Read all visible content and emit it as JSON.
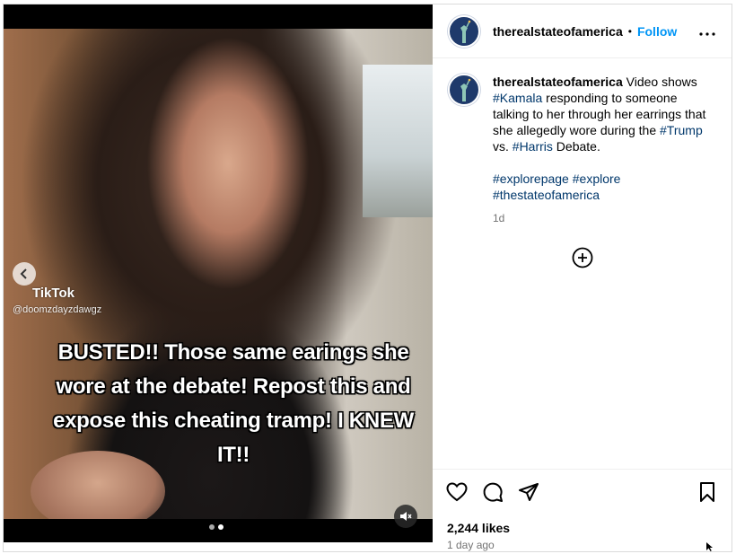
{
  "post": {
    "username": "therealstateofamerica",
    "separator": "•",
    "follow_label": "Follow",
    "more_label": "•••"
  },
  "media": {
    "watermark_brand": "TikTok",
    "watermark_handle": "@doomzdayzdawgz",
    "overlay_text": "BUSTED!! Those same earings she wore at the debate! Repost this and expose this cheating tramp! I KNEW IT!!",
    "slide_count": 2,
    "active_slide": 2
  },
  "caption": {
    "username": "therealstateofamerica",
    "t1": " Video shows ",
    "h1": "#Kamala",
    "t2": " responding to someone talking to her through her earrings that she allegedly wore during the ",
    "h2": "#Trump",
    "t3": " vs. ",
    "h3": "#Harris",
    "t4": " Debate.",
    "h4": "#explorepage",
    "h5": "#explore",
    "h6": "#thestateofamerica",
    "time": "1d"
  },
  "footer": {
    "likes": "2,244 likes",
    "posted": "1 day ago"
  },
  "icons": {
    "like": "heart-icon",
    "comment": "comment-icon",
    "share": "share-icon",
    "save": "bookmark-icon",
    "mute": "muted-speaker-icon",
    "add": "plus-circle-icon"
  },
  "colors": {
    "link_blue": "#0095f6",
    "hashtag": "#00376b",
    "muted_text": "#737373"
  }
}
